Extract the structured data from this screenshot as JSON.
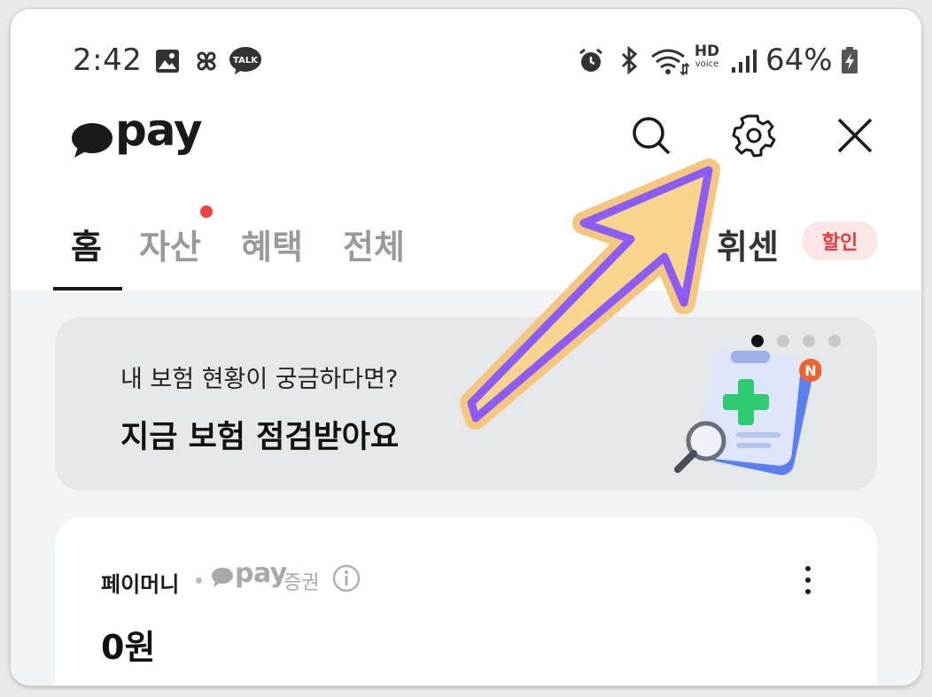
{
  "status_bar": {
    "time": "2:42",
    "network_label": "HD",
    "network_sub": "voice",
    "battery": "64%"
  },
  "header": {
    "logo_text": "pay"
  },
  "tabs": [
    {
      "label": "홈",
      "active": true
    },
    {
      "label": "자산",
      "active": false,
      "has_dot": true
    },
    {
      "label": "혜택",
      "active": false
    },
    {
      "label": "전체",
      "active": false
    }
  ],
  "promo_tab": {
    "label": "휘센",
    "badge": "할인"
  },
  "banner": {
    "subtitle": "내 보험 현황이 궁금하다면?",
    "title": "지금 보험 점검받아요",
    "page_index": 1,
    "page_count": 4,
    "new_badge": "N"
  },
  "money_card": {
    "label": "페이머니",
    "provider_logo_text": "pay",
    "provider_suffix": "증권",
    "amount": "0원"
  },
  "colors": {
    "notification_dot": "#f04242",
    "badge_bg": "#fde6e6",
    "badge_text": "#e43c3c",
    "arrow_fill": "#8b5cf6",
    "arrow_outline": "#f5c77e"
  }
}
